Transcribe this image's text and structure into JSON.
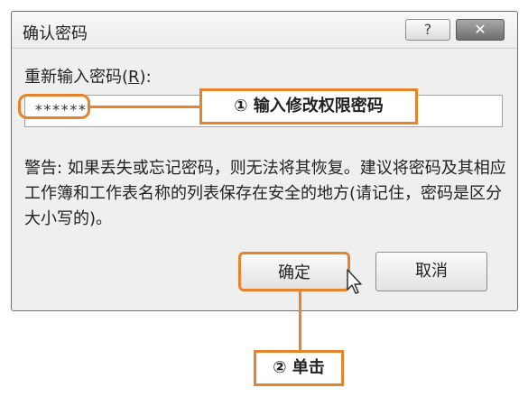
{
  "dialog": {
    "title": "确认密码",
    "help_symbol": "?",
    "close_symbol": "✕",
    "password_label_prefix": "重新输入密码(",
    "password_label_key": "R",
    "password_label_suffix": "):",
    "password_value": "******",
    "warning_text": "警告: 如果丢失或忘记密码，则无法将其恢复。建议将密码及其相应工作簿和工作表名称的列表保存在安全的地方(请记住，密码是区分大小写的)。",
    "ok_label": "确定",
    "cancel_label": "取消"
  },
  "annotations": {
    "step1": "① 输入修改权限密码",
    "step2": "② 单击",
    "accent_color": "#e8832d"
  },
  "icons": {
    "help": "help-icon",
    "close": "close-icon",
    "cursor": "mouse-pointer-icon"
  }
}
